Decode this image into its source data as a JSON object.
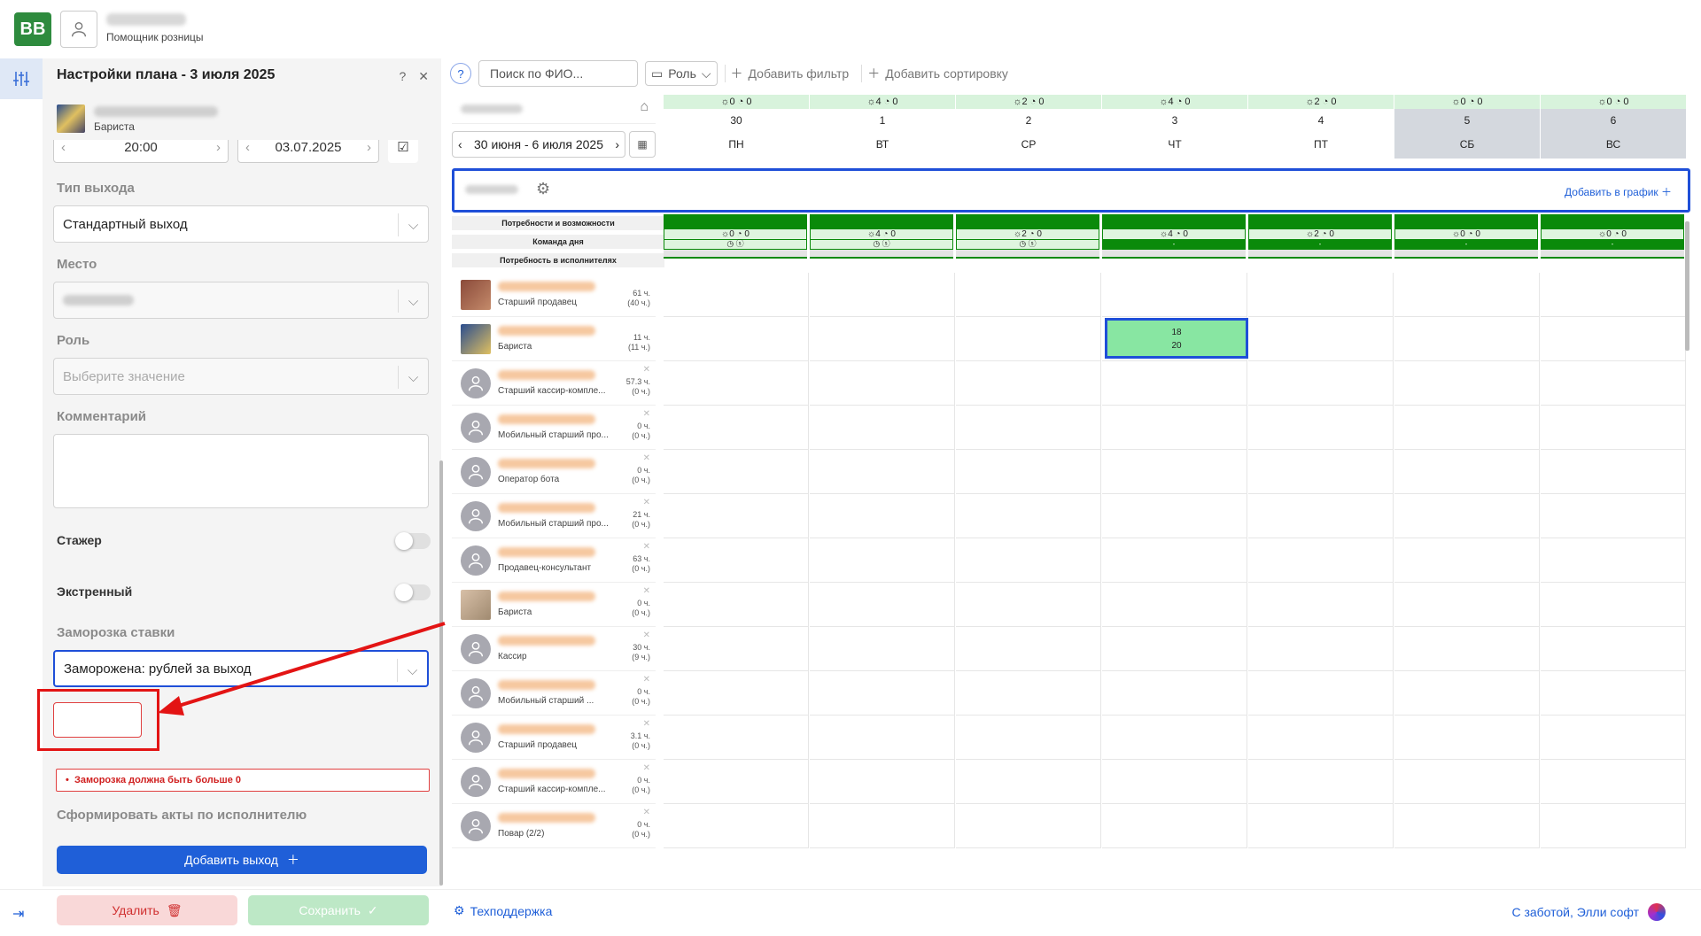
{
  "app": {
    "logo": "BB",
    "user_role": "Помощник розницы"
  },
  "panel": {
    "title": "Настройки плана - 3 июля 2025",
    "employee_role": "Бариста",
    "time_value": "20:00",
    "date_value": "03.07.2025",
    "exit_type_label": "Тип выхода",
    "exit_type_value": "Стандартный выход",
    "place_label": "Место",
    "role_label": "Роль",
    "role_placeholder": "Выберите значение",
    "comment_label": "Комментарий",
    "intern_label": "Стажер",
    "emergency_label": "Экстренный",
    "freeze_label": "Заморозка ставки",
    "freeze_value": "Заморожена: рублей за выход",
    "error_text": "Заморозка должна быть больше 0",
    "acts_label": "Сформировать акты по исполнителю",
    "add_exit_button": "Добавить выход",
    "delete_button": "Удалить",
    "save_button": "Сохранить"
  },
  "footer": {
    "support": "Техподдержка",
    "credit": "С заботой, Элли софт"
  },
  "toolbar": {
    "search_placeholder": "Поиск по ФИО...",
    "role_button": "Роль",
    "add_filter": "Добавить фильтр",
    "add_sort": "Добавить сортировку"
  },
  "calendar": {
    "week_range": "30 июня - 6 июля 2025",
    "days": [
      {
        "num": "30",
        "wd": "ПН",
        "g": "0 0",
        "weekend": false
      },
      {
        "num": "1",
        "wd": "ВТ",
        "g": "4 0",
        "weekend": false
      },
      {
        "num": "2",
        "wd": "СР",
        "g": "2 0",
        "weekend": false
      },
      {
        "num": "3",
        "wd": "ЧТ",
        "g": "4 0",
        "weekend": false
      },
      {
        "num": "4",
        "wd": "ПТ",
        "g": "2 0",
        "weekend": false
      },
      {
        "num": "5",
        "wd": "СБ",
        "g": "0 0",
        "weekend": true
      },
      {
        "num": "6",
        "wd": "ВС",
        "g": "0 0",
        "weekend": true
      }
    ]
  },
  "group": {
    "add_to_schedule": "Добавить в график"
  },
  "needs": {
    "labels": [
      "Потребности и возможности",
      "Команда дня",
      "Потребность в исполнителях"
    ],
    "cols": [
      "0 0",
      "4 0",
      "2 0",
      "4 0",
      "2 0",
      "0 0",
      "0 0"
    ]
  },
  "employees": [
    {
      "role": "Старший продавец",
      "hours": "61 ч.",
      "sub": "(40 ч.)",
      "av": "ph",
      "x": false
    },
    {
      "role": "Бариста",
      "hours": "11 ч.",
      "sub": "(11 ч.)",
      "av": "ph2",
      "x": false
    },
    {
      "role": "Старший кассир-компле...",
      "hours": "57.3 ч.",
      "sub": "(0 ч.)",
      "av": "",
      "x": true
    },
    {
      "role": "Мобильный старший про...",
      "hours": "0 ч.",
      "sub": "(0 ч.)",
      "av": "",
      "x": true
    },
    {
      "role": "Оператор бота",
      "hours": "0 ч.",
      "sub": "(0 ч.)",
      "av": "",
      "x": true
    },
    {
      "role": "Мобильный старший про...",
      "hours": "21 ч.",
      "sub": "(0 ч.)",
      "av": "",
      "x": true
    },
    {
      "role": "Продавец-консультант",
      "hours": "63 ч.",
      "sub": "(0 ч.)",
      "av": "",
      "x": true
    },
    {
      "role": "Бариста",
      "hours": "0 ч.",
      "sub": "(0 ч.)",
      "av": "ph3",
      "x": true
    },
    {
      "role": "Кассир",
      "hours": "30 ч.",
      "sub": "(9 ч.)",
      "av": "",
      "x": true
    },
    {
      "role": "Мобильный старший ...",
      "hours": "0 ч.",
      "sub": "(0 ч.)",
      "av": "",
      "x": true
    },
    {
      "role": "Старший продавец",
      "hours": "3.1 ч.",
      "sub": "(0 ч.)",
      "av": "",
      "x": true
    },
    {
      "role": "Старший кассир-компле...",
      "hours": "0 ч.",
      "sub": "(0 ч.)",
      "av": "",
      "x": true
    },
    {
      "role": "Повар (2/2)",
      "hours": "0 ч.",
      "sub": "(0 ч.)",
      "av": "",
      "x": true
    }
  ],
  "shift": {
    "start": "18",
    "end": "20"
  }
}
